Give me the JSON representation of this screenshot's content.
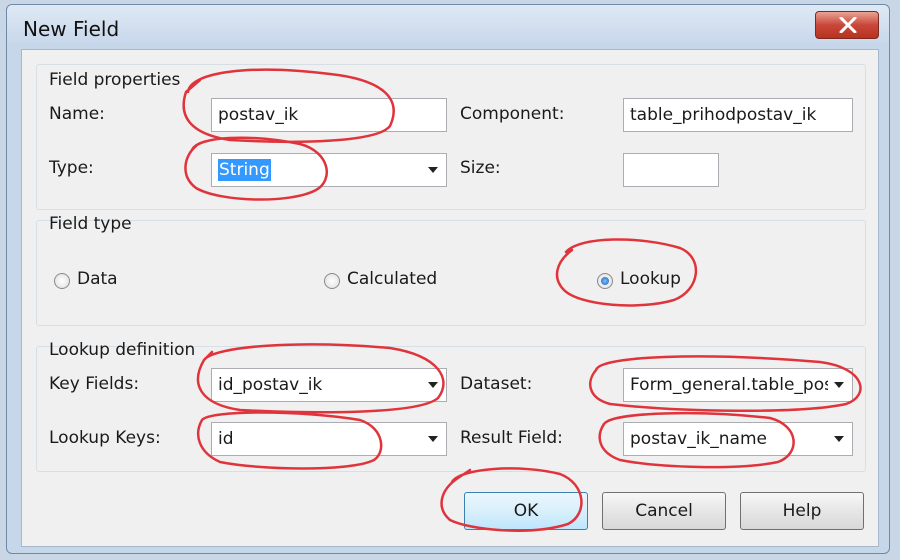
{
  "window": {
    "title": "New Field"
  },
  "field_properties": {
    "legend": "Field properties",
    "name_label": "Name:",
    "name_value": "postav_ik",
    "component_label": "Component:",
    "component_value": "table_prihodpostav_ik",
    "type_label": "Type:",
    "type_value": "String",
    "size_label": "Size:",
    "size_value": ""
  },
  "field_type": {
    "legend": "Field type",
    "options": [
      "Data",
      "Calculated",
      "Lookup"
    ],
    "selected": "Lookup"
  },
  "lookup_definition": {
    "legend": "Lookup definition",
    "key_fields_label": "Key Fields:",
    "key_fields_value": "id_postav_ik",
    "dataset_label": "Dataset:",
    "dataset_value": "Form_general.table_pos",
    "lookup_keys_label": "Lookup Keys:",
    "lookup_keys_value": "id",
    "result_field_label": "Result Field:",
    "result_field_value": "postav_ik_name"
  },
  "buttons": {
    "ok": "OK",
    "cancel": "Cancel",
    "help": "Help"
  },
  "colors": {
    "annotation": "#e0343c",
    "selection": "#3399ff",
    "close": "#c9473a"
  }
}
